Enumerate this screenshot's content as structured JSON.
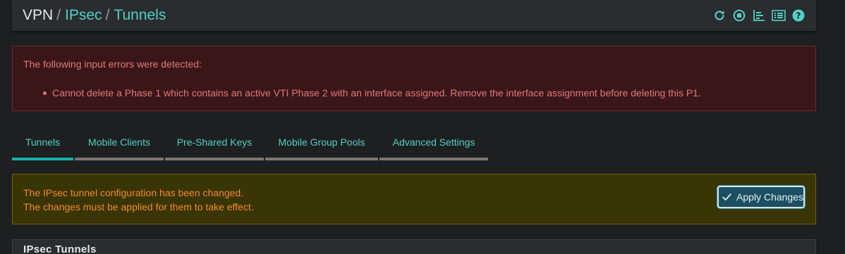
{
  "breadcrumb": {
    "root": "VPN",
    "section": "IPsec",
    "current": "Tunnels"
  },
  "header_icons": [
    {
      "name": "reload-icon"
    },
    {
      "name": "stop-service-icon"
    },
    {
      "name": "status-graph-icon"
    },
    {
      "name": "log-list-icon"
    },
    {
      "name": "help-icon"
    }
  ],
  "error_alert": {
    "title": "The following input errors were detected:",
    "items": [
      "Cannot delete a Phase 1 which contains an active VTI Phase 2 with an interface assigned. Remove the interface assignment before deleting this P1."
    ]
  },
  "tabs": [
    {
      "label": "Tunnels",
      "active": true
    },
    {
      "label": "Mobile Clients",
      "active": false
    },
    {
      "label": "Pre-Shared Keys",
      "active": false
    },
    {
      "label": "Mobile Group Pools",
      "active": false
    },
    {
      "label": "Advanced Settings",
      "active": false
    }
  ],
  "warning_alert": {
    "line1": "The IPsec tunnel configuration has been changed.",
    "line2": "The changes must be applied for them to take effect.",
    "button_label": "Apply Changes"
  },
  "panel": {
    "title": "IPsec Tunnels"
  },
  "colors": {
    "accent": "#4fd1c5",
    "error_text": "#e0787a",
    "warning_text": "#f08a2a",
    "active_tab_underline": "#17b0a6"
  }
}
